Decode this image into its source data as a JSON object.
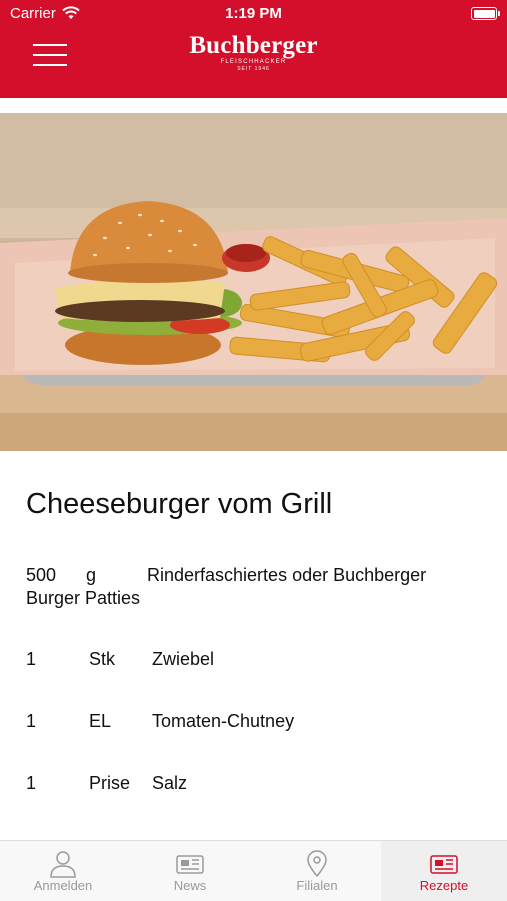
{
  "status_bar": {
    "carrier": "Carrier",
    "time": "1:19 PM"
  },
  "header": {
    "brand": "Buchberger",
    "brand_sub": "FLEISCHHACKER",
    "brand_since": "SEIT 1946"
  },
  "hero": {
    "icon": "burger-and-fries-photo"
  },
  "recipe": {
    "title": "Cheeseburger vom Grill",
    "ingredients": [
      {
        "qty": "500",
        "unit": "g",
        "name": "Rinderfaschiertes oder Buchberger",
        "name_cont": "Burger Patties"
      },
      {
        "qty": "1",
        "unit": "Stk",
        "name": "Zwiebel"
      },
      {
        "qty": "1",
        "unit": "EL",
        "name": "Tomaten-Chutney"
      },
      {
        "qty": "1",
        "unit": "Prise",
        "name": "Salz"
      }
    ]
  },
  "tabbar": {
    "tabs": [
      {
        "label": "Anmelden",
        "icon": "person-icon"
      },
      {
        "label": "News",
        "icon": "newspaper-icon"
      },
      {
        "label": "Filialen",
        "icon": "location-pin-icon"
      },
      {
        "label": "Rezepte",
        "icon": "recipe-icon"
      }
    ],
    "active_index": 3
  },
  "colors": {
    "brand_red": "#d30f2b",
    "tab_inactive": "#9a9a9a"
  }
}
